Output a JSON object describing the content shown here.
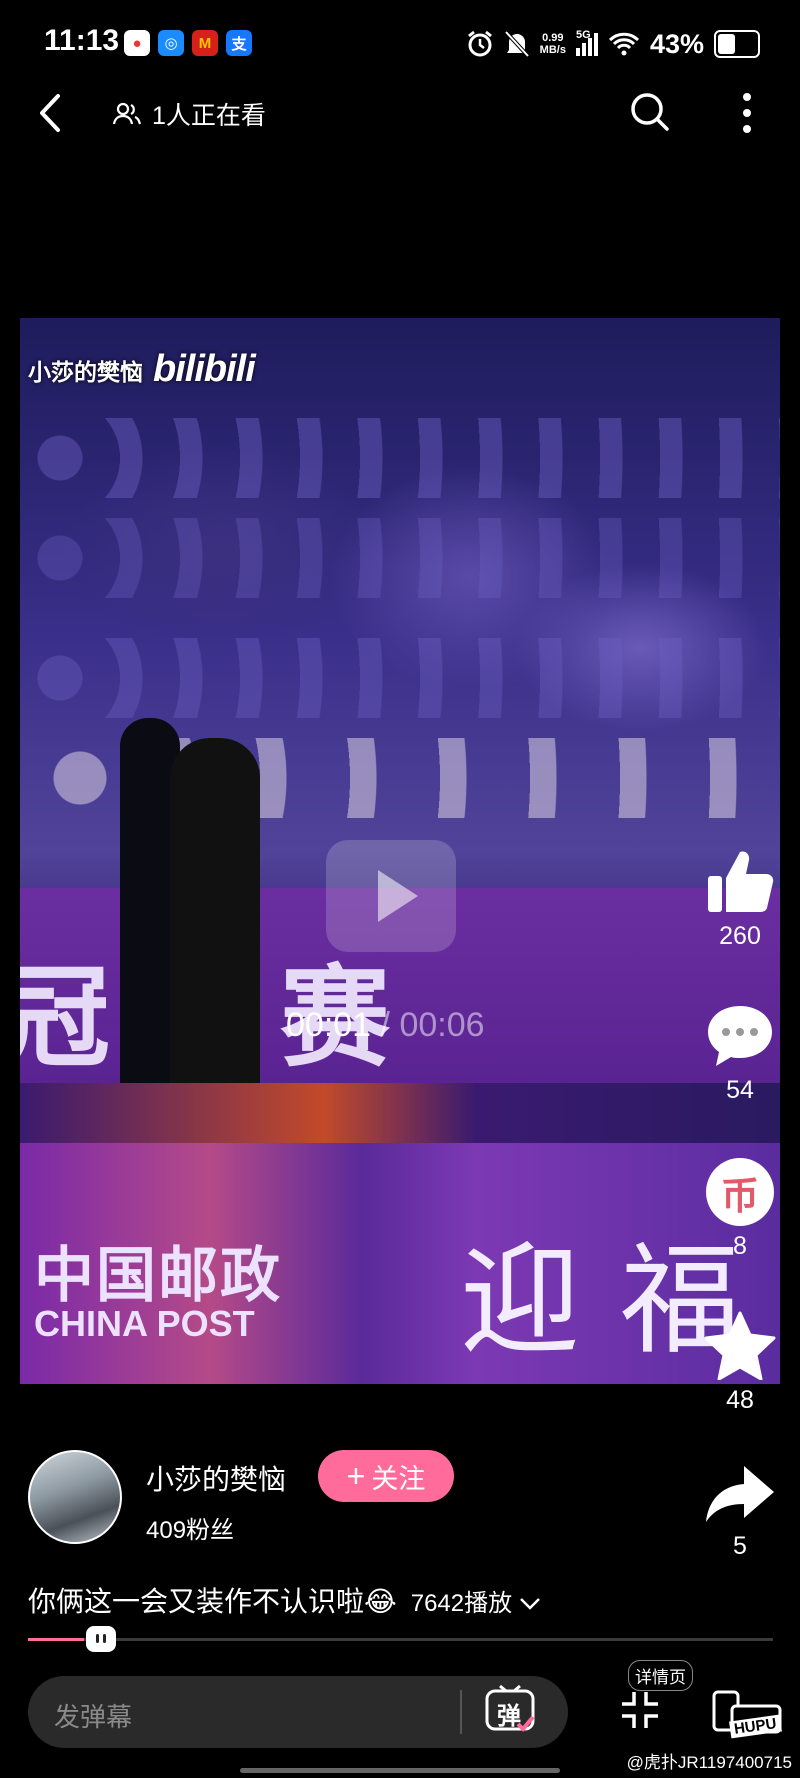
{
  "status_bar": {
    "time": "11:13",
    "net_speed": "0.99",
    "net_unit": "MB/s",
    "signal": "5G",
    "battery": "43%"
  },
  "top_bar": {
    "viewers": "1人正在看"
  },
  "video": {
    "watermark_name": "小莎的樊恼",
    "watermark_logo": "bilibili",
    "current_time": "00:01",
    "separator": "/",
    "total_time": "00:06",
    "banner_text": "中国邮政",
    "banner_text_en": "CHINA POST",
    "banner_right": "迎福",
    "arena_text": "冠级赛"
  },
  "actions": {
    "likes": "260",
    "comments": "54",
    "coins": "8",
    "coin_glyph": "币",
    "favorites": "48",
    "shares": "5"
  },
  "author": {
    "name": "小莎的樊恼",
    "fans": "409粉丝",
    "follow_label": "关注"
  },
  "caption": {
    "text": "你俩这一会又装作不认识啦😂",
    "plays": "7642播放"
  },
  "bottom": {
    "danmu_placeholder": "发弹幕",
    "danmu_btn": "弹",
    "detail_label": "详情页",
    "hupu": "HUPU",
    "credit": "@虎扑JR1197400715"
  },
  "colors": {
    "accent": "#ff6b9a",
    "background": "#000000"
  }
}
